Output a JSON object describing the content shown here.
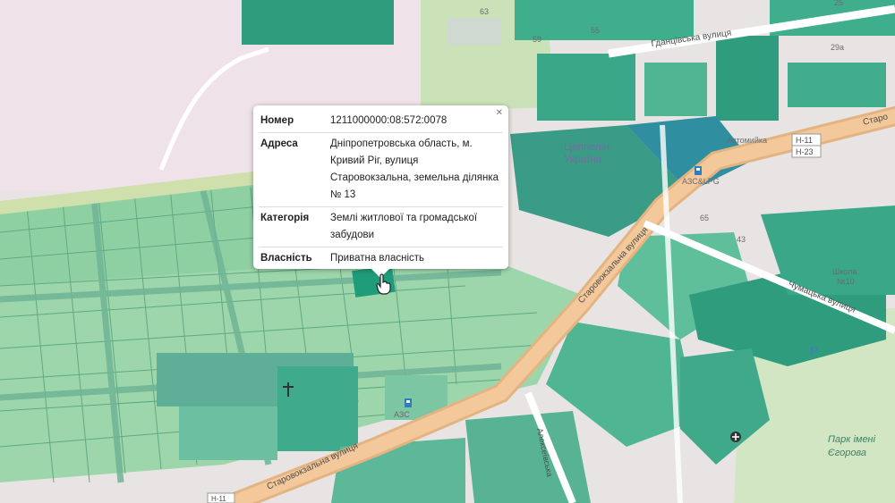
{
  "popup": {
    "close_icon": "close-icon",
    "rows": [
      {
        "key": "Номер",
        "value": "1211000000:08:572:0078"
      },
      {
        "key": "Адреса",
        "value": "Дніпропетровська область, м. Кривий Ріг, вулиця Старовокзальна, земельна ділянка № 13"
      },
      {
        "key": "Категорія",
        "value": "Землі житлової та громадської забудови"
      },
      {
        "key": "Власність",
        "value": "Приватна власність"
      }
    ]
  },
  "map": {
    "streets": {
      "gdantsivska": "Гданцівська вулиця",
      "starovokzalna_1": "Старовокзальна вулиця",
      "starovokzalna_2": "Старовокзальна вулиця",
      "starovokzalna_3": "Старо",
      "chumatska": "Чумацька вулиця",
      "aleksiivska": "Алексеївська"
    },
    "road_refs": {
      "h11": "Н-11",
      "h23": "Н-23",
      "h11_bottom": "Н-11"
    },
    "places": {
      "tseppelin_1": "Цеппелін",
      "tseppelin_2": "Україна",
      "park_1": "Парк імені",
      "park_2": "Єгорова",
      "azs": "АЗС&LPG",
      "avtomiika": "Автомийка",
      "shkola_1": "Школа",
      "shkola_2": "№10",
      "azs_bottom": "АЗС"
    },
    "house_numbers": [
      "63",
      "59",
      "55",
      "29а",
      "25",
      "65",
      "43"
    ],
    "icons": {
      "fuel": "fuel-icon",
      "parking": "parking-icon",
      "church": "cross-icon",
      "hospital": "cross-circle-icon",
      "pointer": "hand-pointer-icon"
    },
    "parking_letter": "P",
    "colors": {
      "background": "#e9e4e4",
      "parcel_light": "#8fd0a3",
      "parcel_teal": "#3fa98a",
      "parcel_selected": "#1f9c79",
      "main_road": "#f3c89a",
      "park": "#d3e6c4"
    }
  }
}
